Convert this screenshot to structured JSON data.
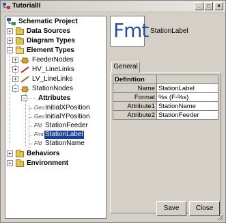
{
  "window": {
    "title": "TutorialII"
  },
  "tree": {
    "root": "Schematic Project",
    "data_sources": "Data Sources",
    "diagram_types": "Diagram Types",
    "element_types": "Element Types",
    "feeder_nodes": "FeederNodes",
    "hv_linelinks": "HV_LineLinks",
    "lv_linelinks": "LV_LineLinks",
    "station_nodes": "StationNodes",
    "attributes": "Attributes",
    "attr_items": [
      {
        "prefix": "Geo",
        "label": "InitialXPosition"
      },
      {
        "prefix": "Geo",
        "label": "InitialYPosition"
      },
      {
        "prefix": "Fld",
        "label": "StationFeeder"
      },
      {
        "prefix": "Fmt",
        "label": "StationLabel"
      },
      {
        "prefix": "Fld",
        "label": "StationName"
      }
    ],
    "behaviors": "Behaviors",
    "environment": "Environment"
  },
  "detail": {
    "icon_text": "Fmt",
    "name": "StationLabel",
    "tab": "General",
    "section": "Definition",
    "rows": [
      {
        "key": "Name",
        "value": "StationLabel"
      },
      {
        "key": "Format",
        "value": "%s (F-%s)"
      },
      {
        "key": "Attribute1",
        "value": "StationName"
      },
      {
        "key": "Attribute2",
        "value": "StationFeeder"
      }
    ]
  },
  "buttons": {
    "save": "Save",
    "close": "Close"
  },
  "colors": {
    "selection": "#1a3fa3",
    "fmt_icon": "#1f4f9d"
  }
}
